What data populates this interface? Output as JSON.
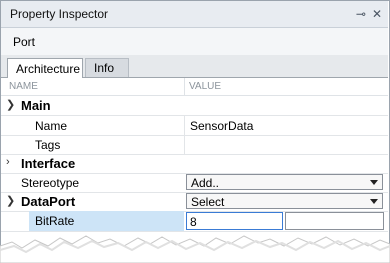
{
  "window": {
    "title": "Property Inspector",
    "pin_icon": "pin-icon",
    "close_icon": "close-icon"
  },
  "subject": "Port",
  "tabs": [
    {
      "label": "Architecture",
      "active": true
    },
    {
      "label": "Info",
      "active": false
    }
  ],
  "columns": {
    "name": "NAME",
    "value": "VALUE"
  },
  "rows": [
    {
      "type": "category",
      "label": "Main",
      "expanded": true
    },
    {
      "type": "property",
      "label": "Name",
      "value": "SensorData"
    },
    {
      "type": "property",
      "label": "Tags",
      "value": ""
    },
    {
      "type": "category",
      "label": "Interface",
      "expanded": false
    },
    {
      "type": "dropdown",
      "label": "Stereotype",
      "value": "Add.."
    },
    {
      "type": "category-dropdown",
      "label": "DataPort",
      "value": "Select",
      "expanded": true
    },
    {
      "type": "editing",
      "label": "BitRate",
      "value": "8"
    }
  ],
  "colors": {
    "selection": "#cde4f7",
    "titlebar": "#e8ecf1",
    "focus_border": "#3a7bd5"
  }
}
